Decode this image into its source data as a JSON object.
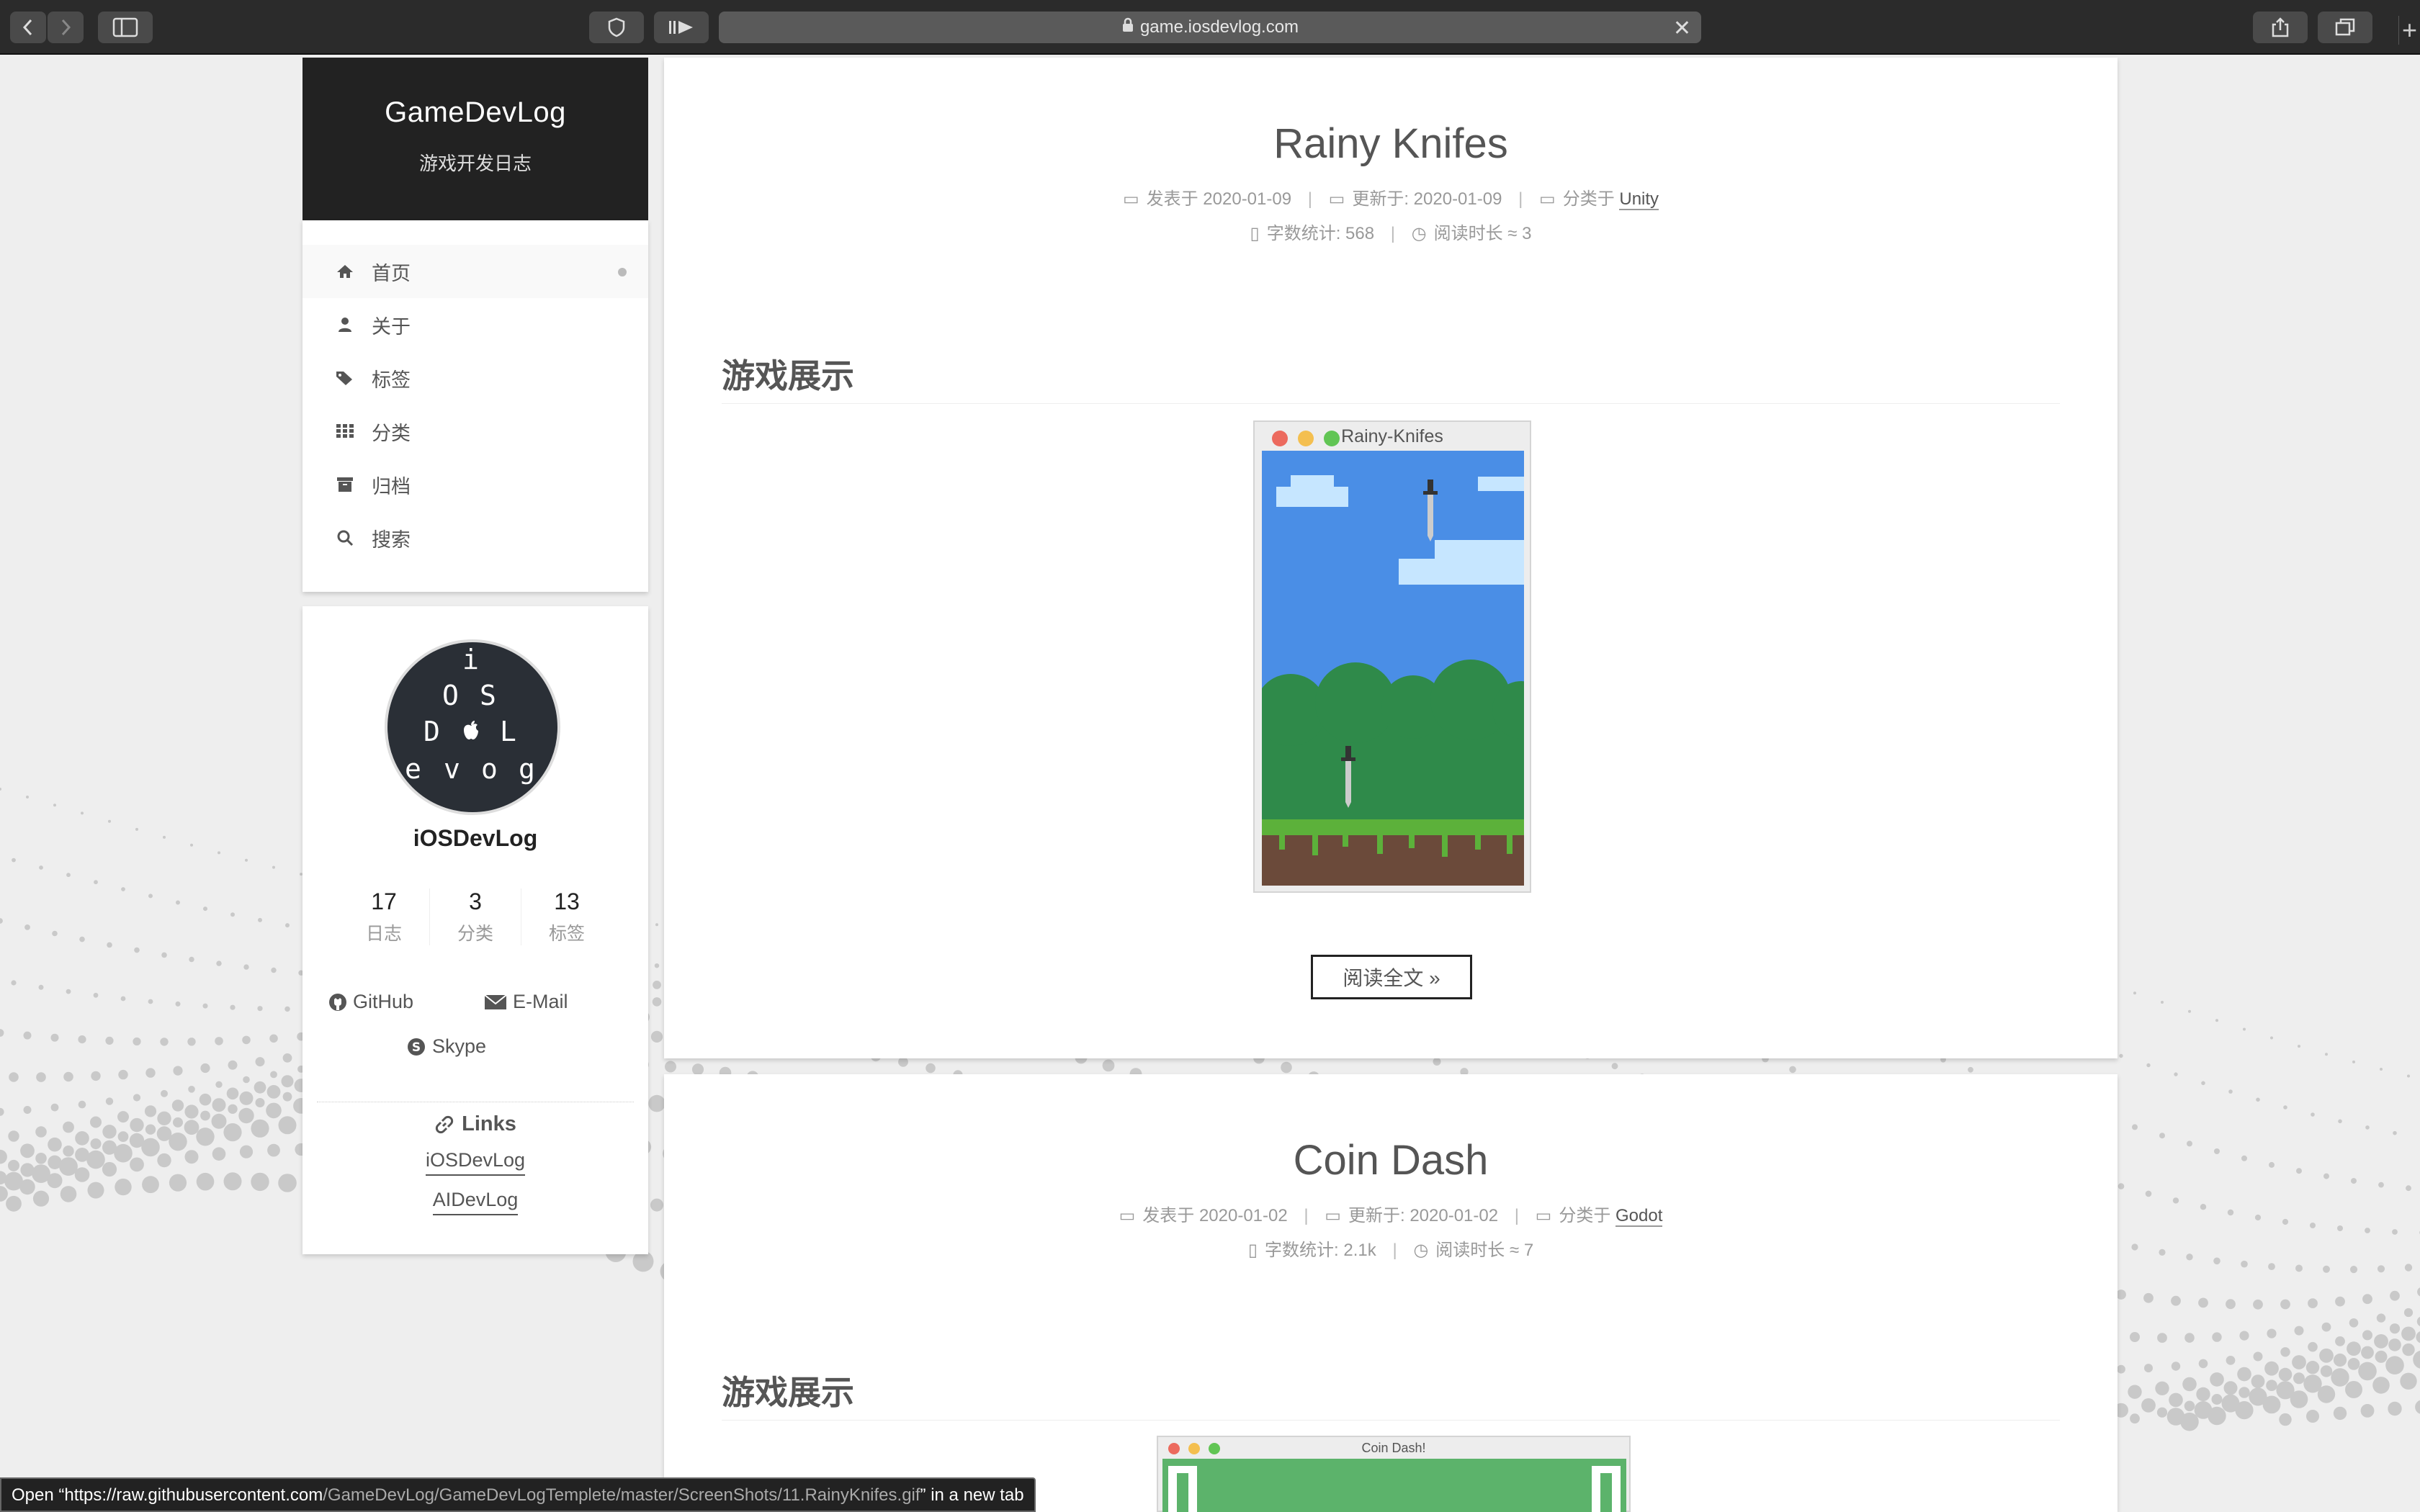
{
  "browser": {
    "url": "game.iosdevlog.com"
  },
  "site": {
    "title": "GameDevLog",
    "subtitle": "游戏开发日志"
  },
  "menu": {
    "items": [
      {
        "label": "首页",
        "icon": "home-icon",
        "active": true
      },
      {
        "label": "关于",
        "icon": "user-icon"
      },
      {
        "label": "标签",
        "icon": "tags-icon"
      },
      {
        "label": "分类",
        "icon": "grid-icon"
      },
      {
        "label": "归档",
        "icon": "archive-icon"
      },
      {
        "label": "搜索",
        "icon": "search-icon"
      }
    ]
  },
  "author": {
    "avatar_letters": {
      "r1": "i",
      "r2a": "O",
      "r2b": "S",
      "r3a": "D",
      "r3b": "L",
      "r4a": "e",
      "r4b": "v",
      "r4c": "o",
      "r4d": "g"
    },
    "name": "iOSDevLog",
    "stats": [
      {
        "num": "17",
        "label": "日志"
      },
      {
        "num": "3",
        "label": "分类"
      },
      {
        "num": "13",
        "label": "标签"
      }
    ],
    "social": {
      "github": "GitHub",
      "email": "E-Mail",
      "skype": "Skype"
    },
    "links_title": "Links",
    "links": [
      "iOSDevLog",
      "AIDevLog"
    ]
  },
  "posts": [
    {
      "title": "Rainy Knifes",
      "posted_label": "发表于",
      "posted": "2020-01-09",
      "updated_label": "更新于:",
      "updated": "2020-01-09",
      "category_label": "分类于",
      "category": "Unity",
      "words_label": "字数统计:",
      "words": "568",
      "readtime_label": "阅读时长 ≈",
      "readtime": "3",
      "section": "游戏展示",
      "window_title": "Rainy-Knifes",
      "read_more": "阅读全文 »"
    },
    {
      "title": "Coin Dash",
      "posted_label": "发表于",
      "posted": "2020-01-02",
      "updated_label": "更新于:",
      "updated": "2020-01-02",
      "category_label": "分类于",
      "category": "Godot",
      "words_label": "字数统计:",
      "words": "2.1k",
      "readtime_label": "阅读时长 ≈",
      "readtime": "7",
      "section": "游戏展示",
      "window_title": "Coin Dash!"
    }
  ],
  "status": {
    "prefix": "Open “https://raw.githubusercontent.com",
    "path": "/GameDevLog/GameDevLogTemplete/master/ScreenShots/11.RainyKnifes.gif",
    "suffix": "” in a new tab"
  },
  "colors": {
    "sidebar_header": "#222222",
    "game_sky": "#4a8ee6",
    "game_grass": "#5cb13a",
    "coin_green": "#5cb36b"
  }
}
